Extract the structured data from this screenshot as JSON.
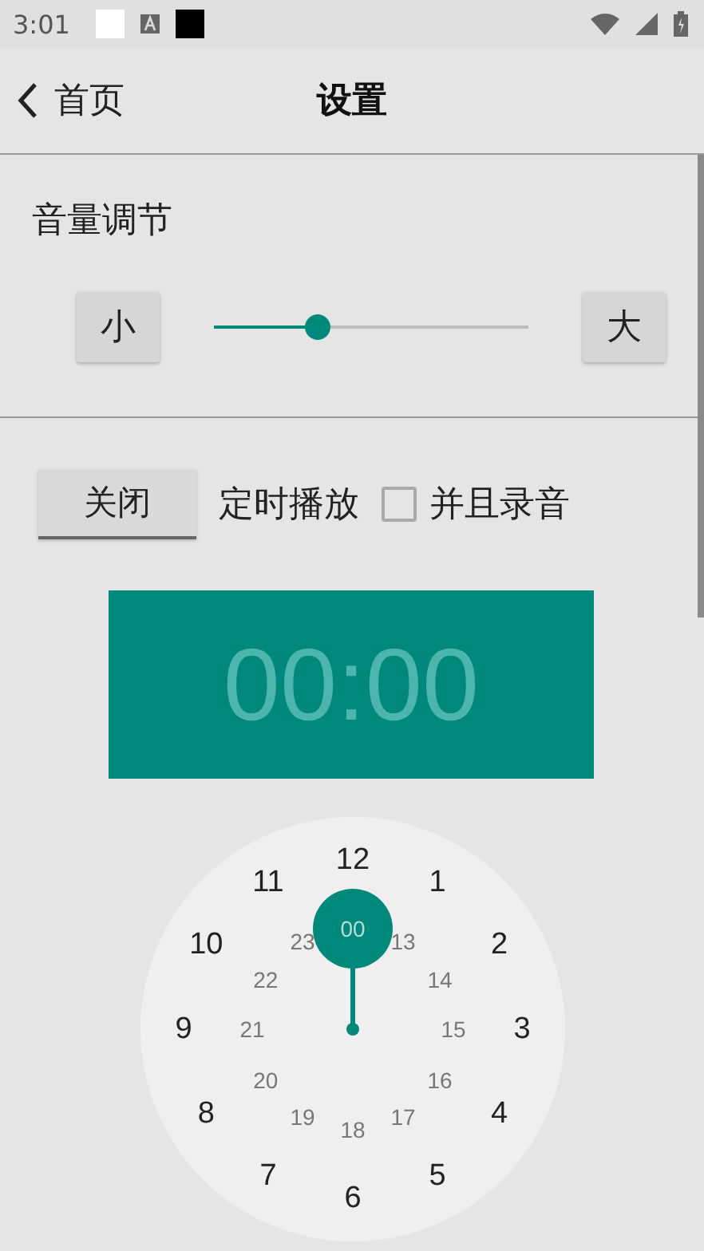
{
  "status_bar": {
    "time": "3:01"
  },
  "toolbar": {
    "back_label": "首页",
    "title": "设置"
  },
  "volume": {
    "title": "音量调节",
    "decrease": "小",
    "increase": "大",
    "level": 0.33
  },
  "timer": {
    "toggle": "关闭",
    "label": "定时播放",
    "record": {
      "label": "并且录音",
      "checked": false
    },
    "display": "00:00"
  },
  "clock": {
    "outer": [
      {
        "label": "12",
        "selected": false
      },
      {
        "label": "1",
        "selected": false
      },
      {
        "label": "2",
        "selected": false
      },
      {
        "label": "3",
        "selected": false
      },
      {
        "label": "4",
        "selected": false
      },
      {
        "label": "5",
        "selected": false
      },
      {
        "label": "6",
        "selected": false
      },
      {
        "label": "7",
        "selected": false
      },
      {
        "label": "8",
        "selected": false
      },
      {
        "label": "9",
        "selected": false
      },
      {
        "label": "10",
        "selected": false
      },
      {
        "label": "11",
        "selected": false
      }
    ],
    "inner": [
      {
        "label": "00",
        "selected": true
      },
      {
        "label": "13",
        "selected": false
      },
      {
        "label": "14",
        "selected": false
      },
      {
        "label": "15",
        "selected": false
      },
      {
        "label": "16",
        "selected": false
      },
      {
        "label": "17",
        "selected": false
      },
      {
        "label": "18",
        "selected": false
      },
      {
        "label": "19",
        "selected": false
      },
      {
        "label": "20",
        "selected": false
      },
      {
        "label": "21",
        "selected": false
      },
      {
        "label": "22",
        "selected": false
      },
      {
        "label": "23",
        "selected": false
      }
    ]
  }
}
